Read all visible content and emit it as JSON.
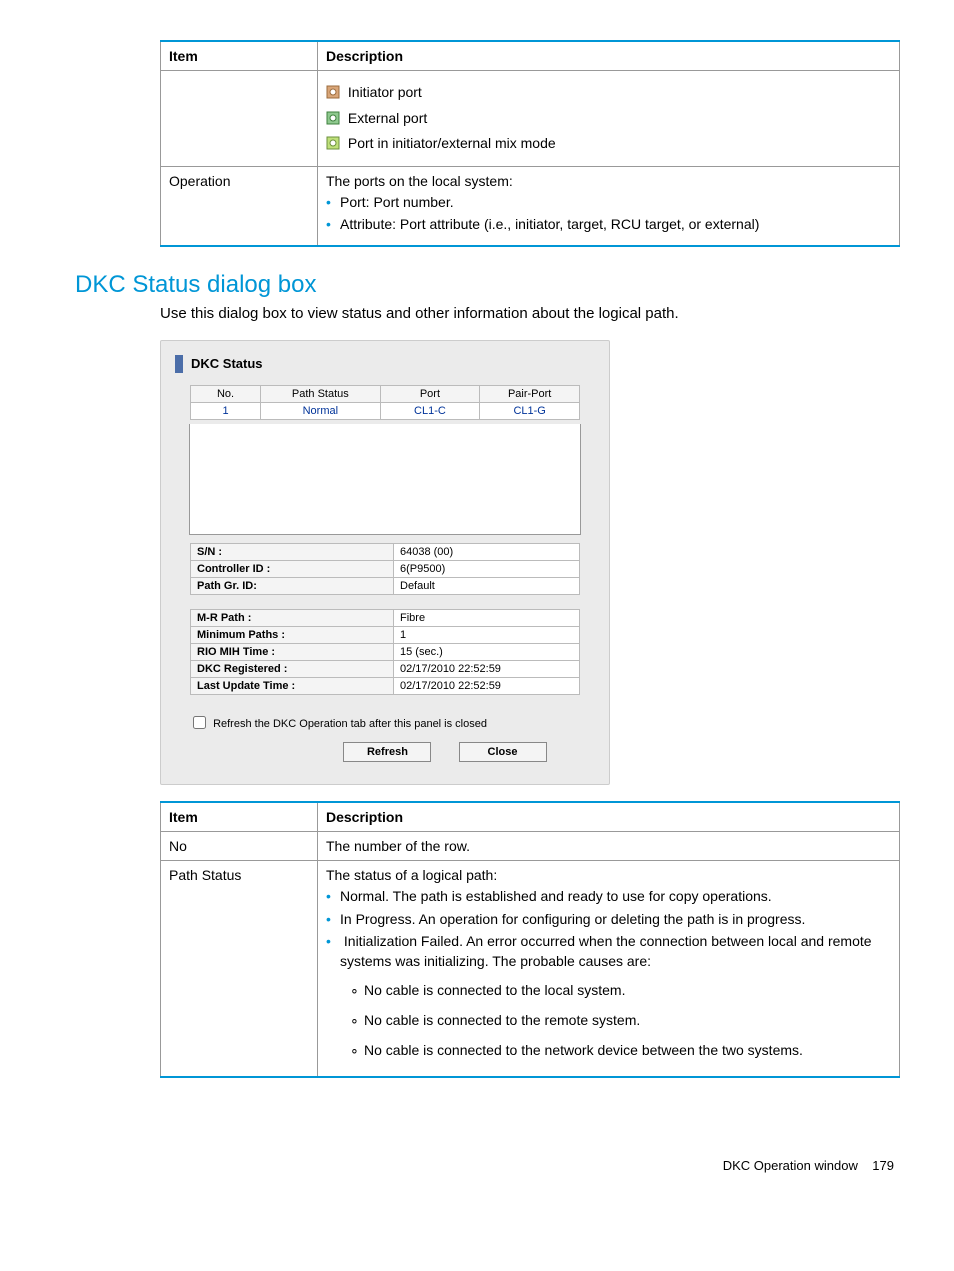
{
  "table1": {
    "headers": {
      "item": "Item",
      "desc": "Description"
    },
    "row1": {
      "icons": {
        "initiator": "Initiator port",
        "external": "External port",
        "mixed": "Port in initiator/external mix mode"
      }
    },
    "row2": {
      "item": "Operation",
      "intro": "The ports on the local system:",
      "bullets": {
        "port": "Port: Port number.",
        "attr": "Attribute: Port attribute (i.e., initiator, target, RCU target, or external)"
      }
    }
  },
  "section": {
    "title": "DKC Status dialog box",
    "intro": "Use this dialog box to view status and other information about the logical path."
  },
  "dialog": {
    "title": "DKC Status",
    "path_headers": {
      "no": "No.",
      "status": "Path Status",
      "port": "Port",
      "pairport": "Pair-Port"
    },
    "path_row": {
      "no": "1",
      "status": "Normal",
      "port": "CL1-C",
      "pairport": "CL1-G"
    },
    "info": {
      "sn_label": "S/N :",
      "sn_val": "64038 (00)",
      "ctrl_label": "Controller ID :",
      "ctrl_val": "6(P9500)",
      "pgid_label": "Path Gr. ID:",
      "pgid_val": "Default",
      "mrpath_label": "M-R Path :",
      "mrpath_val": "Fibre",
      "minp_label": "Minimum Paths :",
      "minp_val": "1",
      "rio_label": "RIO MIH Time :",
      "rio_val": "15 (sec.)",
      "dkcreg_label": "DKC Registered :",
      "dkcreg_val": "02/17/2010 22:52:59",
      "lut_label": "Last Update Time :",
      "lut_val": "02/17/2010 22:52:59"
    },
    "refresh_checkbox": "Refresh the DKC Operation tab after this panel is closed",
    "buttons": {
      "refresh": "Refresh",
      "close": "Close"
    }
  },
  "table2": {
    "headers": {
      "item": "Item",
      "desc": "Description"
    },
    "row_no": {
      "item": "No",
      "desc": "The number of the row."
    },
    "row_ps": {
      "item": "Path Status",
      "intro": "The status of a logical path:",
      "b1": "Normal. The path is established and ready to use for copy operations.",
      "b2": "In Progress. An operation for configuring or deleting the path is in progress.",
      "b3": "Initialization Failed. An error occurred when the connection between local and remote systems was initializing. The probable causes are:",
      "s1": "No cable is connected to the local system.",
      "s2": "No cable is connected to the remote system.",
      "s3": "No cable is connected to the network device between the two systems."
    }
  },
  "footer": {
    "text": "DKC Operation window",
    "page": "179"
  }
}
